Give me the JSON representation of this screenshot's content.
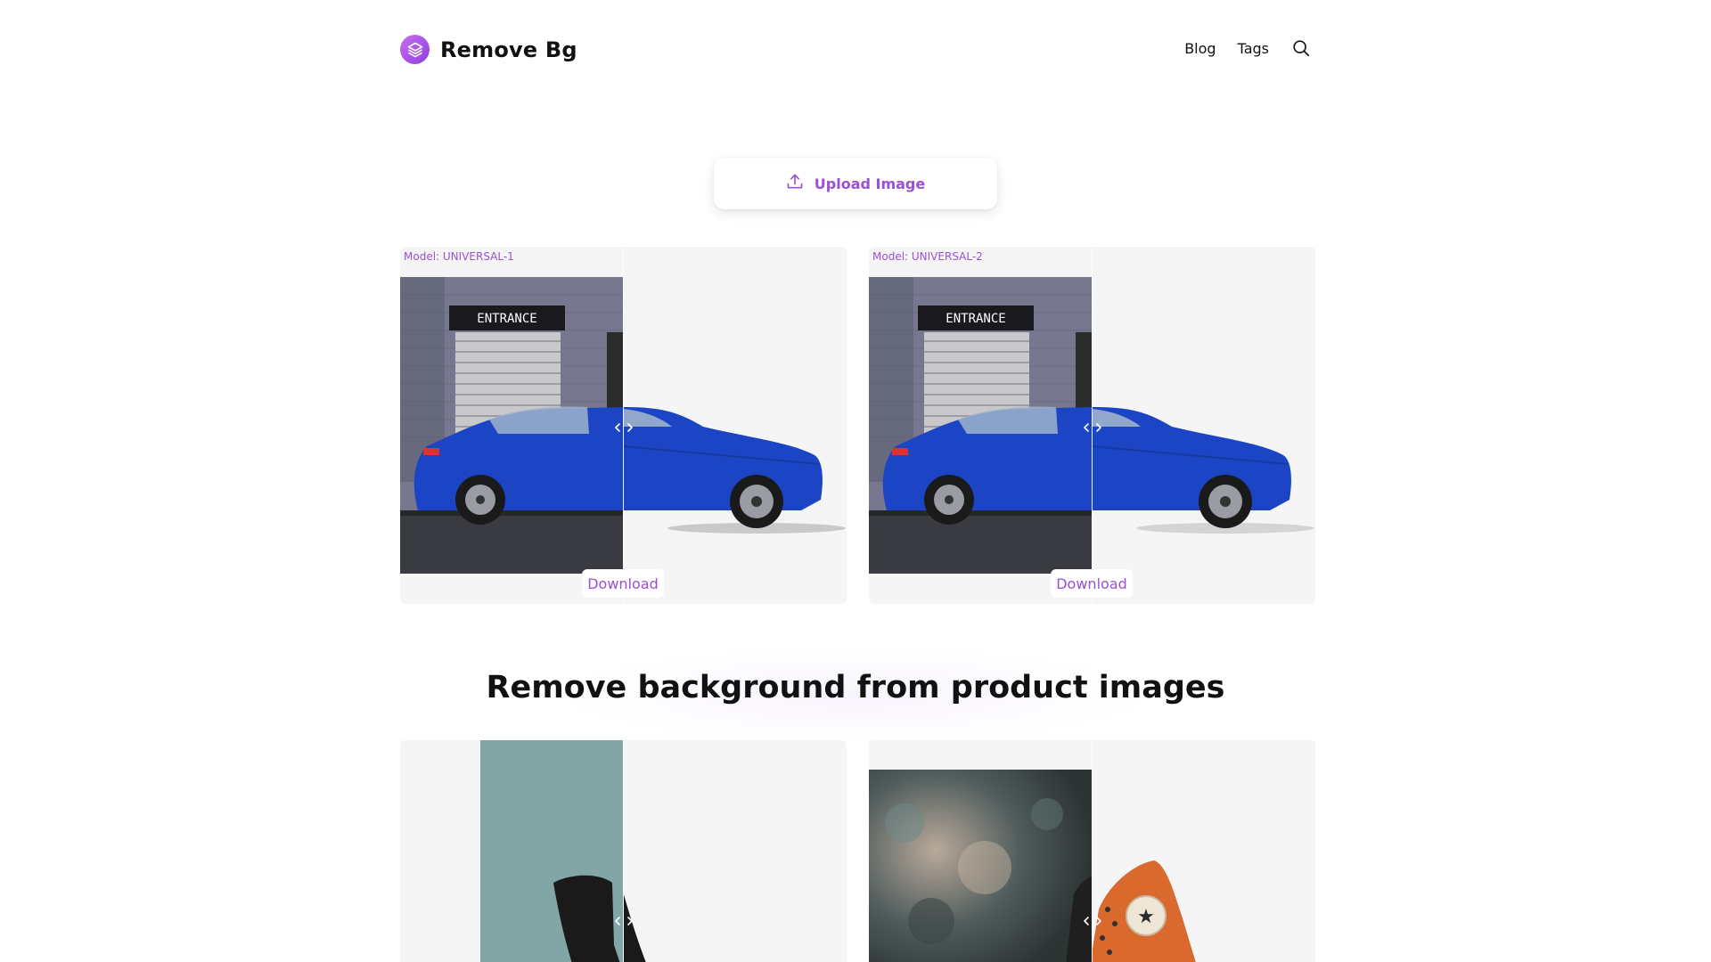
{
  "brand": {
    "name": "Remove Bg"
  },
  "nav": {
    "blog": "Blog",
    "tags": "Tags"
  },
  "upload": {
    "label": "Upload Image"
  },
  "examples": [
    {
      "model": "Model: UNIVERSAL-1",
      "download": "Download"
    },
    {
      "model": "Model: UNIVERSAL-2",
      "download": "Download"
    }
  ],
  "section": {
    "title": "Remove background from product images"
  },
  "sign": {
    "text": "ENTRANCE"
  },
  "colors": {
    "accent": "#9b4fd6",
    "card_bg": "#f5f5f6",
    "car_blue": "#1b45c4"
  }
}
